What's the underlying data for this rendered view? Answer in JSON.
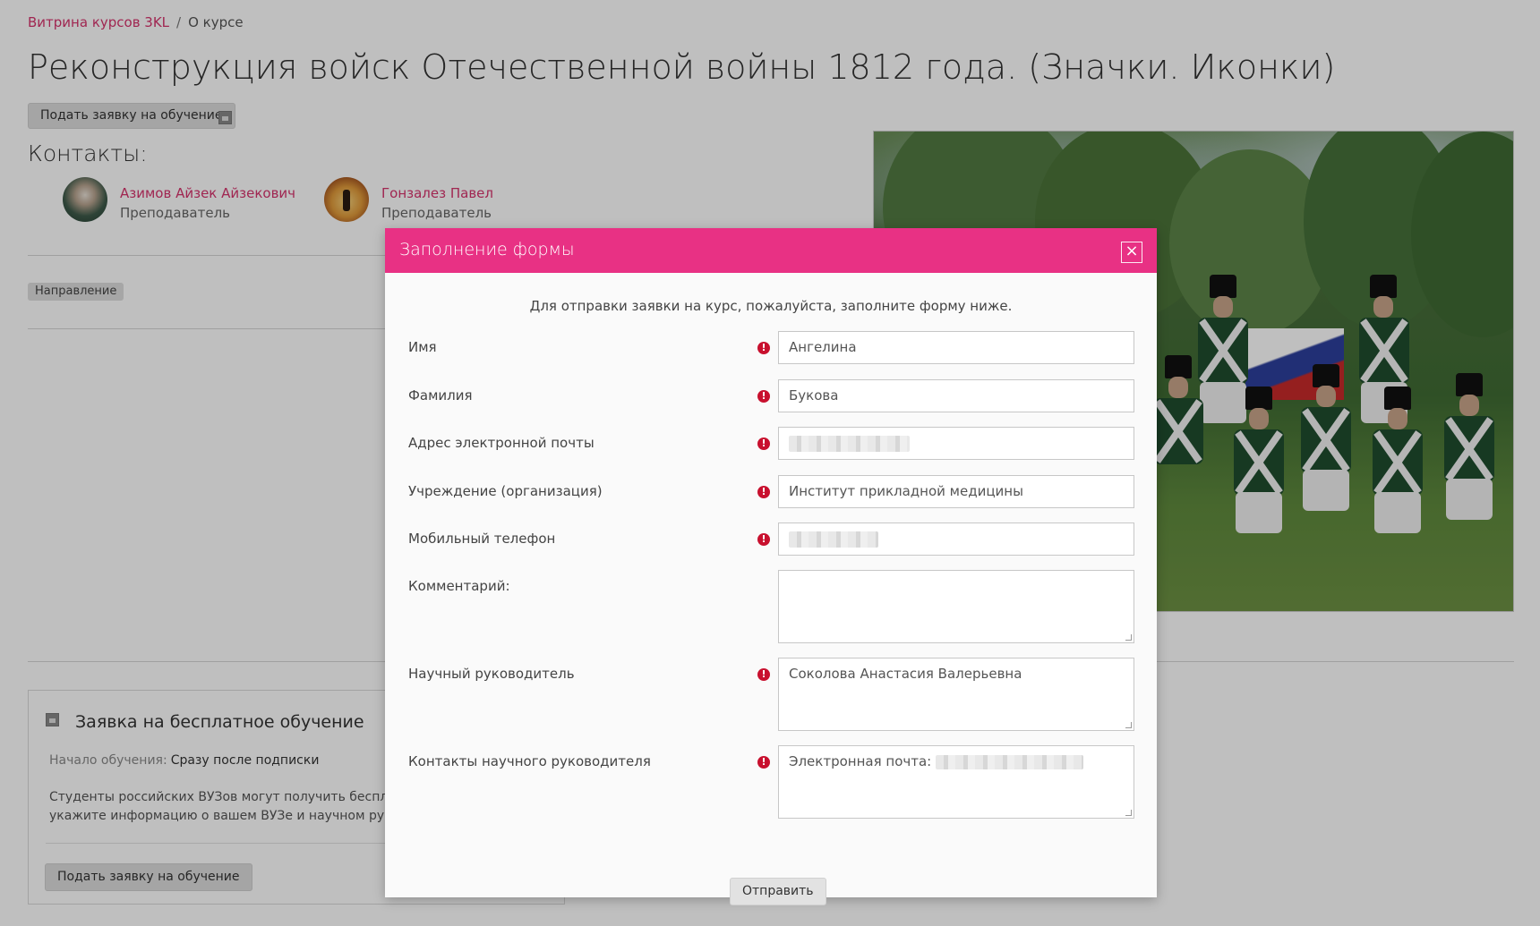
{
  "breadcrumb": {
    "home": "Витрина курсов 3KL",
    "separator": "/",
    "current": "О курсе"
  },
  "course": {
    "title": "Реконструкция войск Отечественной войны 1812 года. (Значки. Иконки)",
    "apply_button": "Подать заявку на обучение"
  },
  "contacts": {
    "title": "Контакты:",
    "people": [
      {
        "name": "Азимов Айзек Айзекович",
        "role": "Преподаватель"
      },
      {
        "name": "Гонзалез Павел",
        "role": "Преподаватель"
      }
    ]
  },
  "tag": "Направление",
  "card": {
    "title": "Заявка на бесплатное обучение",
    "start_label": "Начало обучения:",
    "start_value": "Сразу после подписки",
    "text_line1": "Студенты российских ВУЗов могут получить бесплатный",
    "text_line2": "укажите информацию о вашем ВУЗе и научном руководи",
    "button": "Подать заявку на обучение"
  },
  "modal": {
    "title": "Заполнение формы",
    "close": "×",
    "intro": "Для отправки заявки на курс, пожалуйста, заполните форму ниже.",
    "required_mark": "!",
    "fields": {
      "first_name": {
        "label": "Имя",
        "value": "Ангелина"
      },
      "last_name": {
        "label": "Фамилия",
        "value": "Букова"
      },
      "email": {
        "label": "Адрес электронной почты"
      },
      "organization": {
        "label": "Учреждение (организация)",
        "value": "Институт прикладной медицины"
      },
      "phone": {
        "label": "Мобильный телефон"
      },
      "comment": {
        "label": "Комментарий:",
        "value": ""
      },
      "supervisor": {
        "label": "Научный руководитель",
        "value": "Соколова Анастасия Валерьевна"
      },
      "supervisor_contacts": {
        "label": "Контакты научного руководителя",
        "value": "Электронная почта:"
      }
    },
    "submit": "Отправить"
  },
  "colors": {
    "accent": "#e83184",
    "link": "#d6336c",
    "required": "#c8102e"
  }
}
